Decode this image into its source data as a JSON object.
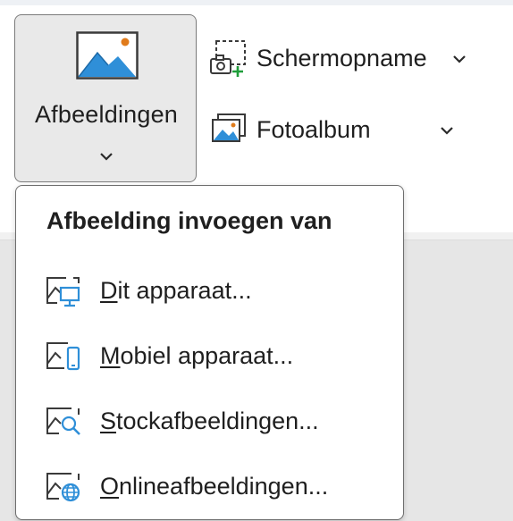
{
  "colors": {
    "accent_blue": "#2f8fd8",
    "accent_orange": "#e07b1b",
    "accent_green": "#1f9d3a",
    "icon_stroke": "#3a3a3a"
  },
  "ribbon": {
    "pictures_button": {
      "label": "Afbeeldingen",
      "icon": "picture-icon",
      "dropdown_icon": "chevron-down-icon"
    },
    "screenshot_button": {
      "label": "Schermopname",
      "icon": "screenshot-icon",
      "dropdown_icon": "chevron-down-icon"
    },
    "photo_album_button": {
      "label": "Fotoalbum",
      "icon": "photo-album-icon",
      "dropdown_icon": "chevron-down-icon"
    }
  },
  "menu": {
    "title": "Afbeelding invoegen van",
    "items": [
      {
        "access_key": "D",
        "rest": "it apparaat...",
        "icon": "device-picture-icon"
      },
      {
        "access_key": "M",
        "rest": "obiel apparaat...",
        "icon": "mobile-picture-icon"
      },
      {
        "access_key": "S",
        "rest": "tockafbeeldingen...",
        "icon": "stock-images-icon"
      },
      {
        "access_key": "O",
        "rest": "nlineafbeeldingen...",
        "icon": "online-pictures-icon"
      }
    ]
  }
}
